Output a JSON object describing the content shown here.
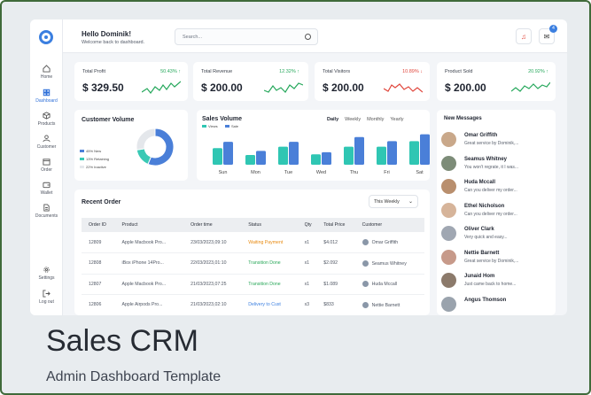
{
  "header": {
    "greeting": "Hello Dominik!",
    "subtitle": "Welcome back to dashboard.",
    "search_placeholder": "Search...",
    "mail_badge": "4"
  },
  "sidebar": {
    "items": [
      {
        "label": "Home"
      },
      {
        "label": "Dashboard"
      },
      {
        "label": "Products"
      },
      {
        "label": "Customer"
      },
      {
        "label": "Order"
      },
      {
        "label": "Wallet"
      },
      {
        "label": "Documents"
      }
    ],
    "settings": "Settings",
    "logout": "Log out"
  },
  "stats": [
    {
      "label": "Total Profit",
      "value": "$ 329.50",
      "change": "50.43% ↑",
      "trend": "up"
    },
    {
      "label": "Total Revenue",
      "value": "$ 200.00",
      "change": "12.32% ↑",
      "trend": "up"
    },
    {
      "label": "Total Visitors",
      "value": "$ 200.00",
      "change": "10.89% ↓",
      "trend": "down"
    },
    {
      "label": "Product Sold",
      "value": "$ 200.00",
      "change": "20.92% ↑",
      "trend": "up"
    }
  ],
  "customer_volume": {
    "title": "Customer Volume",
    "legend": [
      "45% New",
      "13% Retaining",
      "22% Inactive"
    ]
  },
  "sales_volume": {
    "title": "Sales Volume",
    "tabs": [
      "Daily",
      "Weekly",
      "Monthly",
      "Yearly"
    ],
    "legend": [
      "Views",
      "Sale"
    ]
  },
  "chart_data": [
    {
      "type": "pie",
      "title": "Customer Volume",
      "categories": [
        "New",
        "Retaining",
        "Inactive"
      ],
      "values": [
        45,
        13,
        22
      ],
      "colors": [
        "#4a7fd8",
        "#3ac9b5",
        "#e4e7eb"
      ]
    },
    {
      "type": "bar",
      "title": "Sales Volume",
      "categories": [
        "Sun",
        "Mon",
        "Tue",
        "Wed",
        "Thu",
        "Fri",
        "Sat"
      ],
      "series": [
        {
          "name": "Views",
          "color": "#2fc6b3",
          "values": [
            24,
            14,
            26,
            15,
            26,
            26,
            34
          ]
        },
        {
          "name": "Sale",
          "color": "#4a7fd8",
          "values": [
            33,
            20,
            33,
            18,
            40,
            34,
            44
          ]
        }
      ],
      "ylim": [
        0,
        46
      ]
    }
  ],
  "orders": {
    "title": "Recent Order",
    "filter": "This Weekly",
    "columns": [
      "Order ID",
      "Product",
      "Order time",
      "Status",
      "Qty",
      "Total Price",
      "Customer"
    ],
    "rows": [
      {
        "id": "12809",
        "product": "Apple Macbook Pro...",
        "time": "23/03/2023,09:10",
        "status": "Waiting Payment",
        "status_color": "#e88b12",
        "qty": "x1",
        "price": "$4.012",
        "customer": "Omar Griffith"
      },
      {
        "id": "12808",
        "product": "iBox iPhone 14Pro...",
        "time": "22/03/2023,01:10",
        "status": "Transition Done",
        "status_color": "#2aa85a",
        "qty": "x1",
        "price": "$2.092",
        "customer": "Seamus Whitney"
      },
      {
        "id": "12807",
        "product": "Apple Macbook Pro...",
        "time": "21/03/2023,07:25",
        "status": "Transition Done",
        "status_color": "#2aa85a",
        "qty": "x1",
        "price": "$1.089",
        "customer": "Huda Mccall"
      },
      {
        "id": "12806",
        "product": "Apple Airpods Pro...",
        "time": "21/03/2023,02:10",
        "status": "Delivery to Cust",
        "status_color": "#3b7fe0",
        "qty": "x3",
        "price": "$833",
        "customer": "Nettie Barnett"
      }
    ]
  },
  "messages": {
    "title": "New Messages",
    "items": [
      {
        "name": "Omar Griffith",
        "text": "Great service by Dominik,..."
      },
      {
        "name": "Seamus Whitney",
        "text": "You won't regrate, it I was..."
      },
      {
        "name": "Huda Mccall",
        "text": "Can you deliver my order..."
      },
      {
        "name": "Ethel Nicholson",
        "text": "Can you deliver my order..."
      },
      {
        "name": "Oliver Clark",
        "text": "Very quick and easy..."
      },
      {
        "name": "Nettie Barnett",
        "text": "Great service by Dominik,..."
      },
      {
        "name": "Junaid Hom",
        "text": "Just came back to home..."
      },
      {
        "name": "Angus Thomson",
        "text": ""
      }
    ]
  },
  "footer": {
    "title": "Sales CRM",
    "subtitle": "Admin Dashboard Template"
  }
}
